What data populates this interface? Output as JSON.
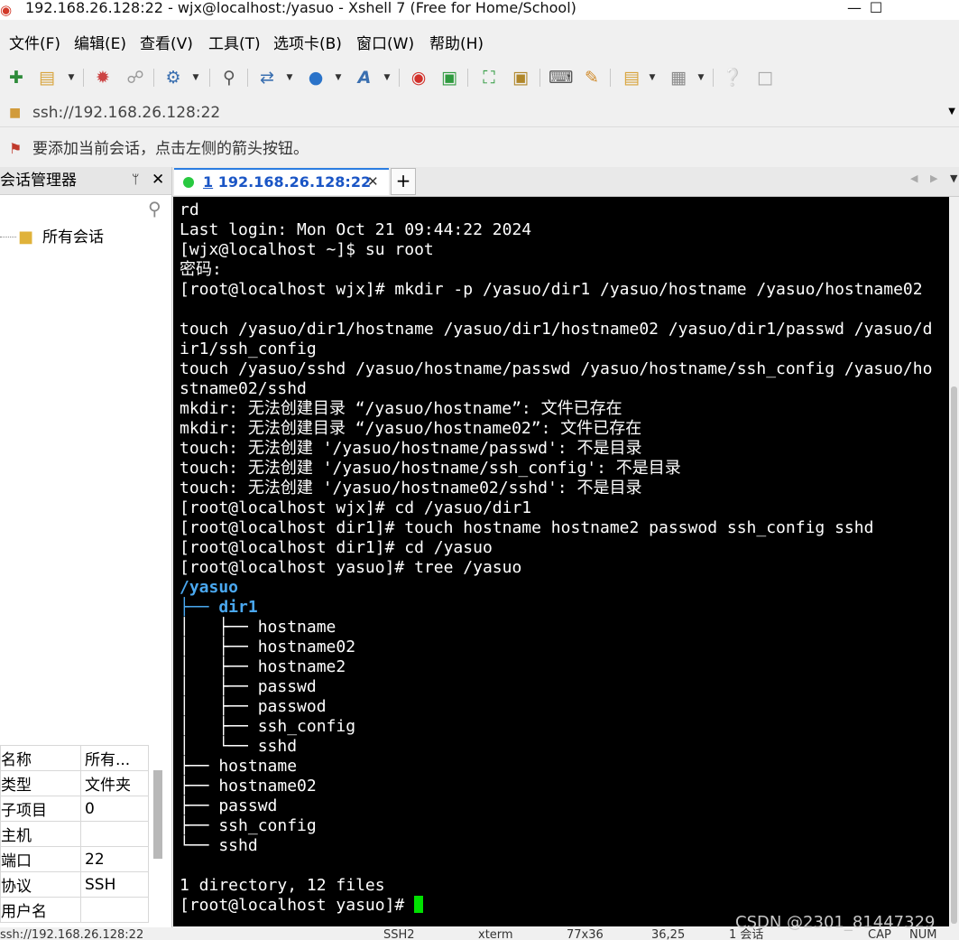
{
  "window": {
    "title": "192.168.26.128:22 - wjx@localhost:/yasuo - Xshell 7 (Free for Home/School)",
    "app_icon": "xshell-icon",
    "controls": {
      "minimize": "—",
      "maximize": "☐"
    }
  },
  "menu": {
    "items": [
      {
        "label": "文件(F)"
      },
      {
        "label": "编辑(E)"
      },
      {
        "label": "查看(V)"
      },
      {
        "label": "工具(T)"
      },
      {
        "label": "选项卡(B)"
      },
      {
        "label": "窗口(W)"
      },
      {
        "label": "帮助(H)"
      }
    ]
  },
  "toolbar": {
    "icons": [
      "new-session-icon",
      "open-folder-icon",
      "reconnect-icon",
      "disconnect-icon",
      "properties-icon",
      "find-icon",
      "transfer-icon",
      "globe-icon",
      "font-icon",
      "xshell-icon",
      "xftp-icon",
      "fullscreen-icon",
      "lock-icon",
      "keyboard-icon",
      "highlighter-icon",
      "script-icon",
      "layout-icon",
      "help-icon",
      "chat-icon"
    ]
  },
  "address": {
    "value": "ssh://192.168.26.128:22"
  },
  "hint": {
    "message": "要添加当前会话，点击左侧的箭头按钮。"
  },
  "session_manager": {
    "title": "会话管理器",
    "pin": "ᛘ",
    "close": "✕",
    "root": "所有会话",
    "properties": [
      {
        "key": "名称",
        "value": "所有..."
      },
      {
        "key": "类型",
        "value": "文件夹"
      },
      {
        "key": "子项目",
        "value": "0"
      },
      {
        "key": "主机",
        "value": ""
      },
      {
        "key": "端口",
        "value": "22"
      },
      {
        "key": "协议",
        "value": "SSH"
      },
      {
        "key": "用户名",
        "value": ""
      }
    ]
  },
  "tabs": {
    "active": {
      "number": "1",
      "label": "192.168.26.128:22"
    },
    "add": "+",
    "status_color": "#28c940"
  },
  "terminal": {
    "lines": [
      {
        "text": "rd"
      },
      {
        "text": "Last login: Mon Oct 21 09:44:22 2024"
      },
      {
        "text": "[wjx@localhost ~]$ su root"
      },
      {
        "text": "密码:"
      },
      {
        "text": "[root@localhost wjx]# mkdir -p /yasuo/dir1 /yasuo/hostname /yasuo/hostname02"
      },
      {
        "text": ""
      },
      {
        "text": "touch /yasuo/dir1/hostname /yasuo/dir1/hostname02 /yasuo/dir1/passwd /yasuo/d"
      },
      {
        "text": "ir1/ssh_config"
      },
      {
        "text": "touch /yasuo/sshd /yasuo/hostname/passwd /yasuo/hostname/ssh_config /yasuo/ho"
      },
      {
        "text": "stname02/sshd"
      },
      {
        "text": "mkdir: 无法创建目录 “/yasuo/hostname”: 文件已存在"
      },
      {
        "text": "mkdir: 无法创建目录 “/yasuo/hostname02”: 文件已存在"
      },
      {
        "text": "touch: 无法创建 '/yasuo/hostname/passwd': 不是目录"
      },
      {
        "text": "touch: 无法创建 '/yasuo/hostname/ssh_config': 不是目录"
      },
      {
        "text": "touch: 无法创建 '/yasuo/hostname02/sshd': 不是目录"
      },
      {
        "text": "[root@localhost wjx]# cd /yasuo/dir1"
      },
      {
        "text": "[root@localhost dir1]# touch hostname hostname2 passwod ssh_config sshd"
      },
      {
        "text": "[root@localhost dir1]# cd /yasuo"
      },
      {
        "text": "[root@localhost yasuo]# tree /yasuo"
      },
      {
        "text": "/yasuo",
        "dir": true
      },
      {
        "text": "├── dir1",
        "dir": true
      },
      {
        "text": "│   ├── hostname"
      },
      {
        "text": "│   ├── hostname02"
      },
      {
        "text": "│   ├── hostname2"
      },
      {
        "text": "│   ├── passwd"
      },
      {
        "text": "│   ├── passwod"
      },
      {
        "text": "│   ├── ssh_config"
      },
      {
        "text": "│   └── sshd"
      },
      {
        "text": "├── hostname"
      },
      {
        "text": "├── hostname02"
      },
      {
        "text": "├── passwd"
      },
      {
        "text": "├── ssh_config"
      },
      {
        "text": "└── sshd"
      },
      {
        "text": ""
      },
      {
        "text": "1 directory, 12 files"
      },
      {
        "text": "[root@localhost yasuo]# "
      }
    ],
    "cursor_color": "#00e000"
  },
  "statusbar": {
    "items": [
      "ssh://192.168.26.128:22",
      "SSH2",
      "xterm",
      "77x36",
      "36,25",
      "1 会话",
      "CAP",
      "NUM"
    ]
  },
  "watermark": "CSDN @2301_81447329"
}
